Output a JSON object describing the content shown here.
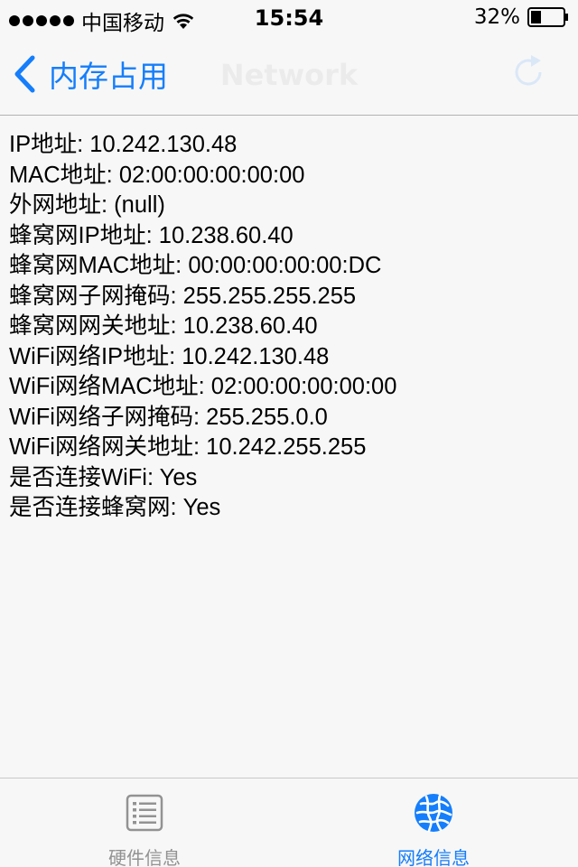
{
  "status_bar": {
    "carrier": "中国移动",
    "time": "15:54",
    "battery": "32%"
  },
  "nav": {
    "back_label": "内存占用",
    "title": "Network"
  },
  "info_lines": [
    "IP地址: 10.242.130.48",
    "MAC地址: 02:00:00:00:00:00",
    "外网地址: (null)",
    "蜂窝网IP地址: 10.238.60.40",
    "蜂窝网MAC地址: 00:00:00:00:00:DC",
    "蜂窝网子网掩码: 255.255.255.255",
    "蜂窝网网关地址: 10.238.60.40",
    "WiFi网络IP地址: 10.242.130.48",
    "WiFi网络MAC地址: 02:00:00:00:00:00",
    "WiFi网络子网掩码: 255.255.0.0",
    "WiFi网络网关地址: 10.242.255.255",
    "是否连接WiFi: Yes",
    "是否连接蜂窝网: Yes"
  ],
  "tabs": [
    {
      "label": "硬件信息",
      "icon": "list-icon",
      "selected": false
    },
    {
      "label": "网络信息",
      "icon": "globe-icon",
      "selected": true
    }
  ],
  "colors": {
    "accent": "#157efb",
    "tab_inactive": "#929292",
    "background": "#f7f7f7"
  }
}
